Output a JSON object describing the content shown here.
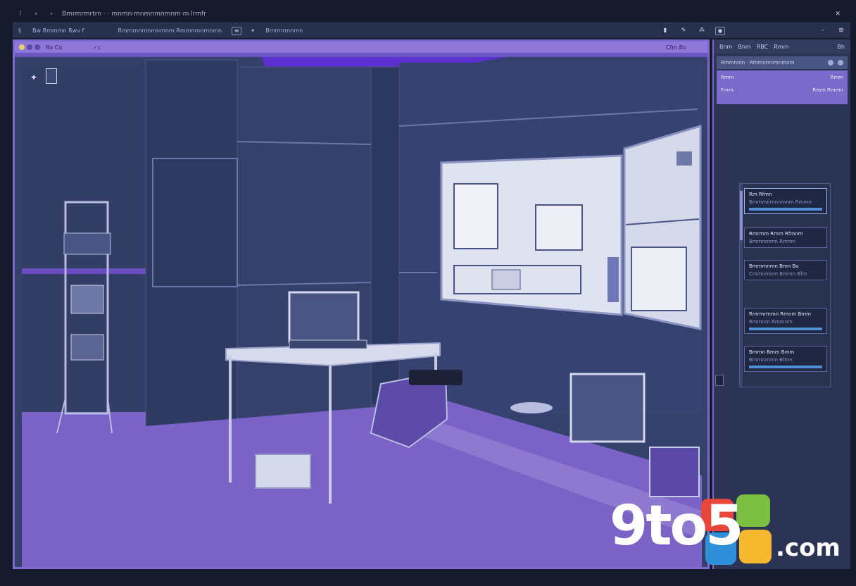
{
  "window": {
    "title": "Bmrmrmrtrn  · ·  mnmn·mnmnmnmnm·m  lrmfr"
  },
  "toolbar": {
    "items": [
      "Bw Rmmmn Rwv f",
      "Rmmmnmnmnmnm  Rmmnmnmnmn",
      "≡",
      "▾",
      "Bmrmrmnmn"
    ],
    "tools": [
      "▮",
      "✎",
      "⁂",
      "◉"
    ]
  },
  "canvas": {
    "header_label": "Ro Co",
    "header_label2": "✓c",
    "header_right": "Cfm Bo",
    "colors": {
      "accent": "#8e78d7",
      "wall": "#34416b",
      "floor": "#7a62c7"
    }
  },
  "panel": {
    "head": [
      "Bnm",
      "Bnm",
      "RBC",
      "Rmm",
      "Bh"
    ],
    "row1": "Rmmnmn  ·  Rmmnmnmnmnm",
    "hl_row1_left": "Rmm",
    "hl_row1_right": "Rmm",
    "hl_row2_left": "Fmm",
    "hl_row2_right": "Rmm Rmmn",
    "layers": [
      {
        "title": "Rm Rfmn",
        "sub": "Bmmmnmnnmnm  Rmmn·",
        "bar": true
      },
      {
        "title": "Rmrmm  Rmm  Rfmnm",
        "sub": "Bmmnmmn  Rmmn",
        "bar": false
      },
      {
        "title": "Bmmmnmn  Bmn  Bu",
        "sub": "Cmmnmnm  Bmmn Bfm",
        "bar": false
      },
      {
        "title": "Rmrmrmmn  Rmnm Bmm",
        "sub": "Rmmnm  Rmmnm",
        "bar": true
      },
      {
        "title": "Bmmn Bmm  Bmm",
        "sub": "Bmmnmmn  Bfmn",
        "bar": true
      }
    ]
  },
  "watermark": {
    "brand": "9to5",
    "suffix": ".com"
  }
}
